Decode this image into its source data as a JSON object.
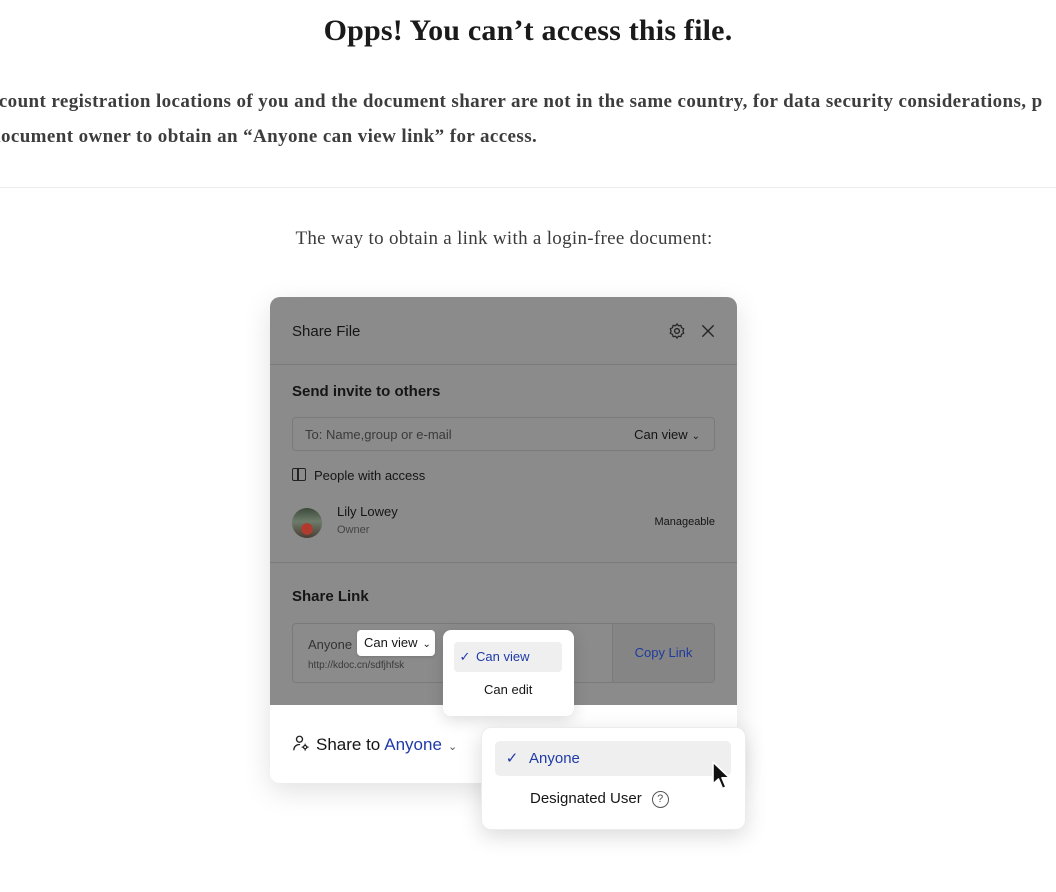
{
  "page": {
    "title": "Opps! You can’t access this file.",
    "description_line1": "ccount registration locations of you and the document sharer are not in the same country, for data security considerations, p",
    "description_line2": "document owner to obtain an “Anyone can view link” for access.",
    "subtitle": "The way to obtain a link with a login-free document:"
  },
  "dialog": {
    "title": "Share File",
    "gear_icon": "gear-icon",
    "close_icon": "close-icon",
    "invite": {
      "heading": "Send invite to others",
      "placeholder": "To: Name,group or e-mail",
      "permission": "Can view"
    },
    "people": {
      "label": "People with access",
      "user_name": "Lily Lowey",
      "user_role": "Owner",
      "user_permission": "Manageable"
    },
    "share_link": {
      "heading": "Share Link",
      "scope": "Anyone",
      "permission": "Can view",
      "url": "http://kdoc.cn/sdfjhfsk",
      "copy_label": "Copy Link"
    },
    "share_to": {
      "label": "Share to",
      "value": "Anyone"
    }
  },
  "permission_menu": {
    "items": [
      "Can view",
      "Can edit"
    ],
    "selected": "Can view"
  },
  "scope_menu": {
    "items": [
      "Anyone",
      "Designated User"
    ],
    "selected": "Anyone"
  },
  "colors": {
    "accent": "#1f3aa8",
    "overlay": "#8b8b8b"
  }
}
